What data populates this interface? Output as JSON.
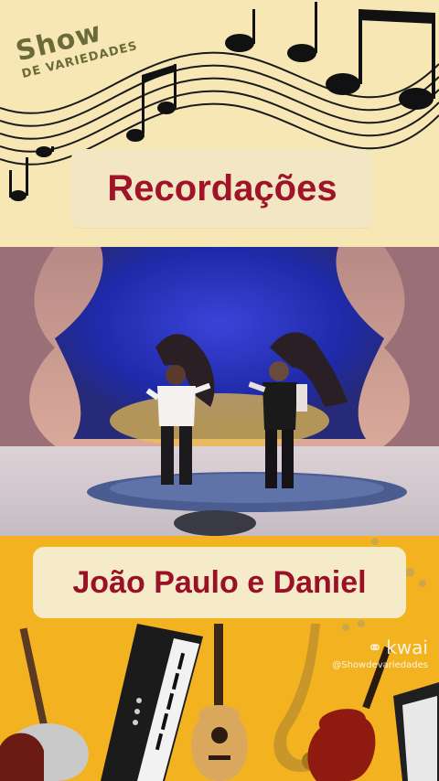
{
  "header": {
    "logo_show": "Show",
    "logo_sub": "DE VARIEDADES",
    "title": "Recordações"
  },
  "video": {
    "scene": "stage-performance-two-singers"
  },
  "footer": {
    "artist": "João Paulo e Daniel",
    "watermark_brand": "kwai",
    "watermark_handle": "@Showdevariedades"
  },
  "colors": {
    "top_bg": "#f6e7b4",
    "bottom_bg": "#f3b321",
    "title_red": "#a0142a",
    "logo_olive": "#6b6a3a"
  }
}
